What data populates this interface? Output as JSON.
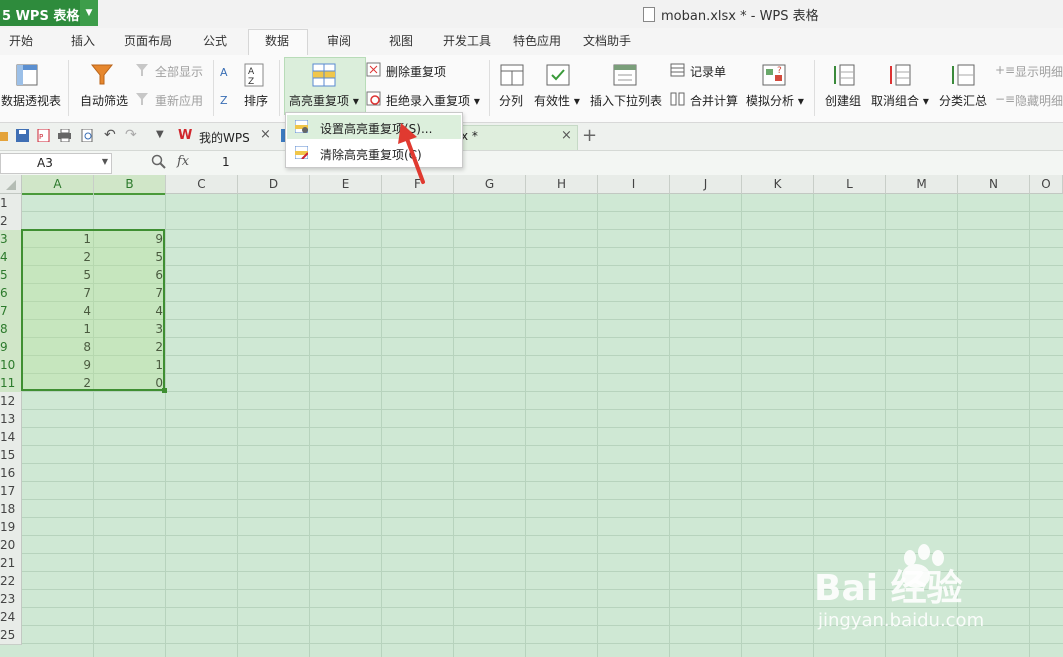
{
  "app": {
    "menu_label": "5 WPS 表格",
    "dropdown_glyph": "▼",
    "window_title": "moban.xlsx * - WPS 表格"
  },
  "tabs": [
    "开始",
    "插入",
    "页面布局",
    "公式",
    "数据",
    "审阅",
    "视图",
    "开发工具",
    "特色应用",
    "文档助手"
  ],
  "active_tab": "数据",
  "ribbon": {
    "pivot": "数据透视表",
    "autofilter": "自动筛选",
    "show_all": "全部显示",
    "reapply": "重新应用",
    "sort": "排序",
    "highlight_dup": "高亮重复项 ▾",
    "delete_dup": "删除重复项",
    "reject_dup": "拒绝录入重复项 ▾",
    "split": "分列",
    "validity": "有效性 ▾",
    "insert_dropdown": "插入下拉列表",
    "record": "记录单",
    "merge_calc": "合并计算",
    "simulate": "模拟分析 ▾",
    "create_group": "创建组",
    "ungroup": "取消组合 ▾",
    "subtotal": "分类汇总",
    "show_detail": "显示明细",
    "hide_detail": "隐藏明细"
  },
  "dropdown": {
    "set_highlight": "设置高亮重复项(S)...",
    "clear_highlight": "清除高亮重复项(C)"
  },
  "doc_tabs": {
    "mywps": "我的WPS",
    "current_suffix": "x *"
  },
  "formula_bar": {
    "cell_ref": "A3",
    "fx": "fx",
    "value": "1"
  },
  "columns": [
    "A",
    "B",
    "C",
    "D",
    "E",
    "F",
    "G",
    "H",
    "I",
    "J",
    "K",
    "L",
    "M",
    "N",
    "O"
  ],
  "rows": [
    "1",
    "2",
    "3",
    "4",
    "5",
    "6",
    "7",
    "8",
    "9",
    "10",
    "11",
    "12",
    "13",
    "14",
    "15",
    "16",
    "17",
    "18",
    "19",
    "20",
    "21",
    "22",
    "23",
    "24",
    "25"
  ],
  "cells": {
    "A": [
      "1",
      "2",
      "5",
      "7",
      "4",
      "1",
      "8",
      "9",
      "2"
    ],
    "B": [
      "9",
      "5",
      "6",
      "7",
      "4",
      "3",
      "2",
      "1",
      "0"
    ]
  },
  "colors": {
    "brand_green": "#2e8b3c",
    "sheet_bg": "#cfe8d4",
    "selection": "#3f8f32",
    "arrow_red": "#e03a30"
  },
  "watermark": {
    "brand": "Bai 经验",
    "url": "jingyan.baidu.com"
  }
}
